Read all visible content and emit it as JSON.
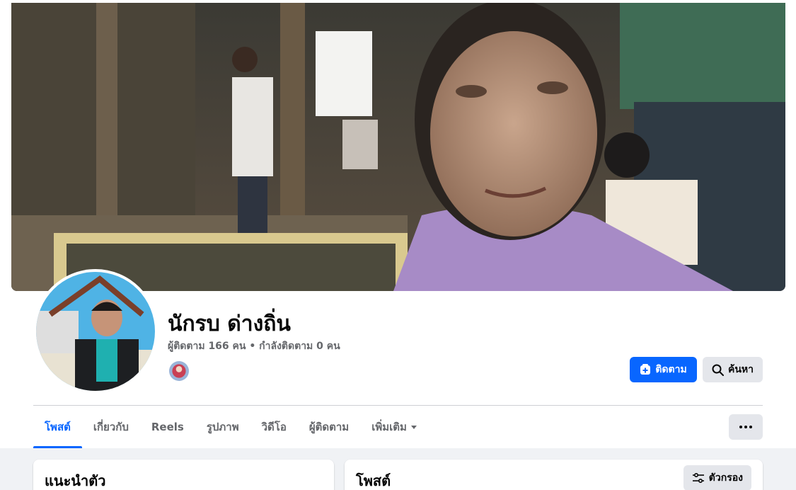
{
  "profile": {
    "name": "นักรบ ด่างถิ่น",
    "stats": "ผู้ติดตาม 166 คน • กำลังติดตาม 0 คน"
  },
  "actions": {
    "follow_label": "ติดตาม",
    "follow_icon": "follow-plus-icon",
    "search_label": "ค้นหา",
    "search_icon": "search-icon"
  },
  "tabs": [
    {
      "label": "โพสต์",
      "active": true
    },
    {
      "label": "เกี่ยวกับ"
    },
    {
      "label": "Reels"
    },
    {
      "label": "รูปภาพ"
    },
    {
      "label": "วิดีโอ"
    },
    {
      "label": "ผู้ติดตาม"
    },
    {
      "label": "เพิ่มเติม"
    }
  ],
  "intro_card": {
    "title": "แนะนำตัว"
  },
  "posts_card": {
    "title": "โพสต์",
    "filter_label": "ตัวกรอง",
    "filter_icon": "filter-icon"
  },
  "colors": {
    "accent": "#0866ff",
    "secondary_btn": "#e4e6eb",
    "muted_text": "#65676b",
    "feed_bg": "#f0f2f5"
  }
}
